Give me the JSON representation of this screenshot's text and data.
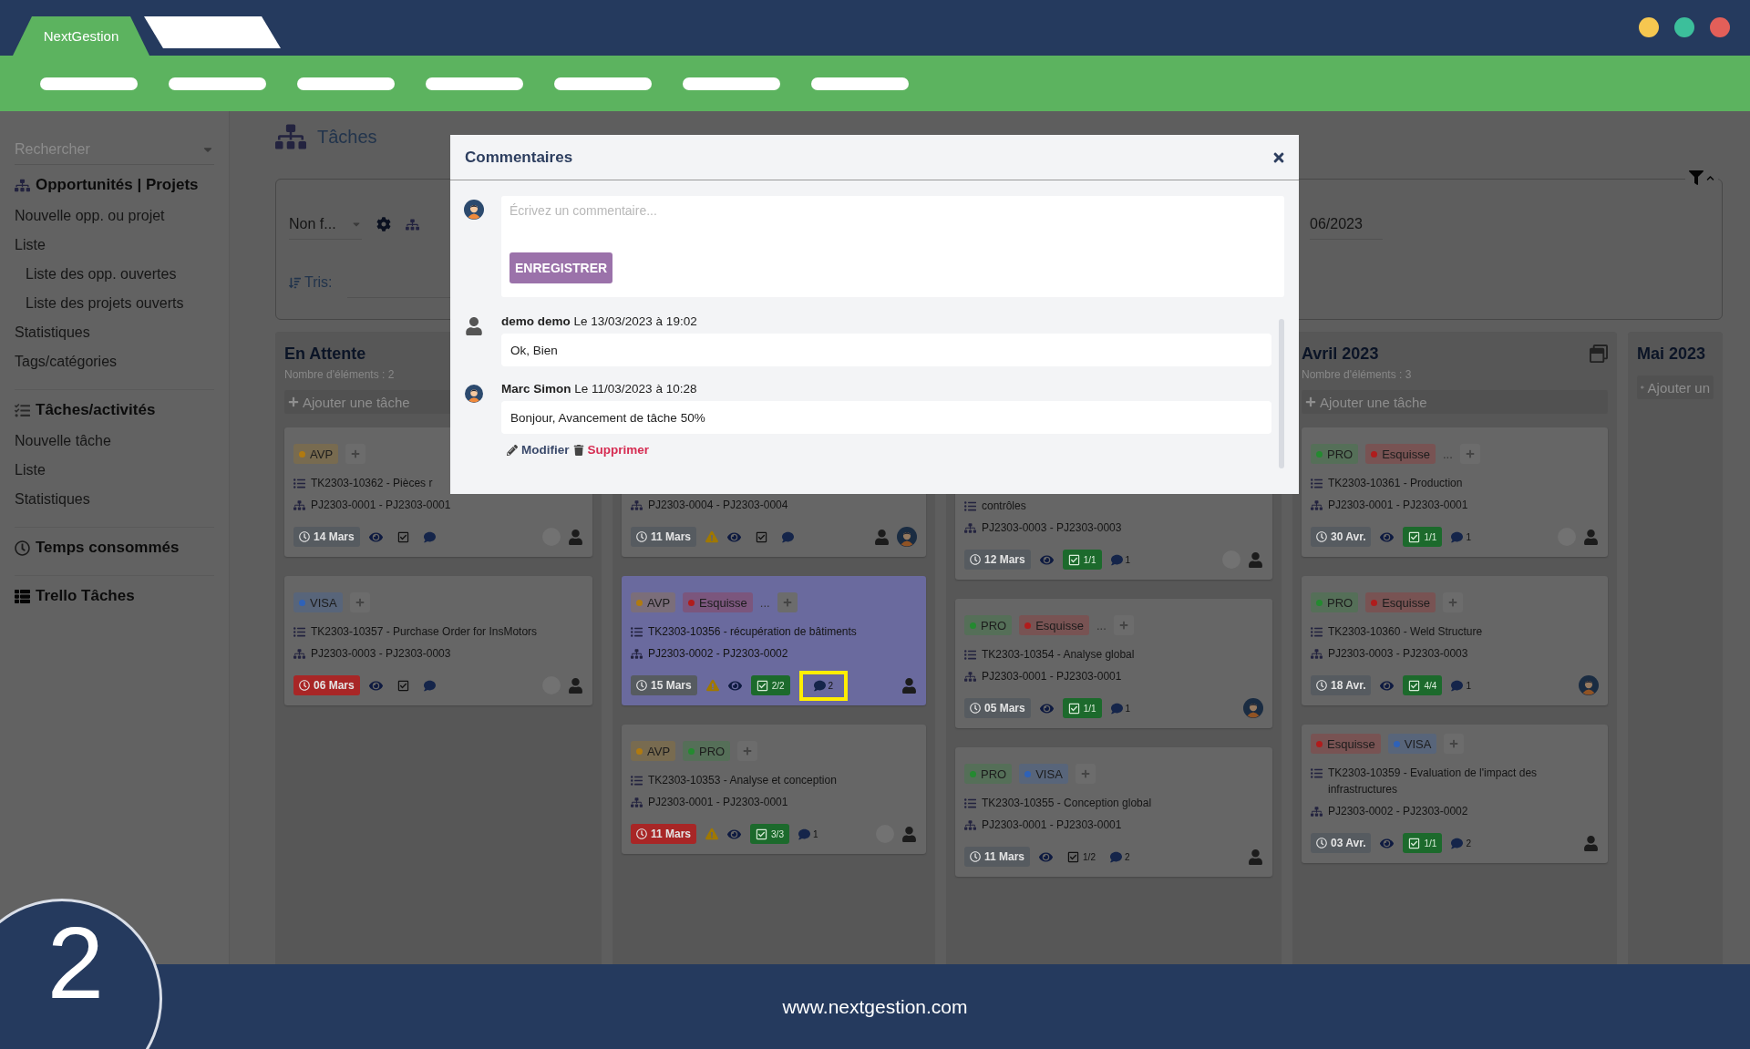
{
  "browser": {
    "tabs": [
      {
        "label": "NextGestion",
        "selected": true
      },
      {
        "selected": false
      }
    ]
  },
  "sidebar": {
    "search": {
      "placeholder": "Rechercher"
    },
    "sections": [
      {
        "title": "Opportunités | Projets",
        "items": [
          {
            "label": "Nouvelle opp. ou projet"
          },
          {
            "label": "Liste",
            "children": [
              {
                "label": "Liste des opp. ouvertes"
              },
              {
                "label": "Liste des projets ouverts"
              }
            ]
          },
          {
            "label": "Statistiques"
          },
          {
            "label": "Tags/catégories"
          }
        ]
      },
      {
        "title": "Tâches/activités",
        "items": [
          {
            "label": "Nouvelle tâche"
          },
          {
            "label": "Liste"
          },
          {
            "label": "Statistiques"
          }
        ]
      },
      {
        "title": "Temps consommés"
      },
      {
        "title": "Trello Tâches"
      }
    ]
  },
  "page": {
    "title": "Tâches"
  },
  "filters": {
    "status": "Non f...",
    "sort_label": "Tris:",
    "period": "06/2023",
    "expanded": true
  },
  "columns": [
    {
      "title": "En Attente",
      "count": "Nombre d'éléments : 2",
      "add": "Ajouter une tâche",
      "collapse_button": false,
      "cards": [
        {
          "tags": [
            {
              "label": "AVP",
              "color": "#b07a10"
            }
          ],
          "task": "TK2303-10362 - Pièces r",
          "project": "PJ2303-0001 - PJ2303-0001",
          "date": "14 Mars",
          "overdue": false,
          "warning": false,
          "checks_done": false,
          "comment_highlight": false,
          "selected": false,
          "assignees": [
            {
              "kind": "empty"
            },
            {
              "kind": "person"
            }
          ]
        },
        {
          "tags": [
            {
              "label": "VISA",
              "color": "#2f62b8"
            }
          ],
          "task": "TK2303-10357 - Purchase Order for InsMotors",
          "project": "PJ2303-0003 - PJ2303-0003",
          "date": "06 Mars",
          "overdue": true,
          "warning": false,
          "checks_done": false,
          "comment_highlight": false,
          "selected": false,
          "assignees": [
            {
              "kind": "empty"
            },
            {
              "kind": "person"
            }
          ]
        }
      ]
    },
    {
      "cards": [
        {
          "project": "PJ2303-0004 - PJ2303-0004",
          "date": "11 Mars",
          "overdue": false,
          "warning": true,
          "checks_done": false,
          "comment_highlight": false,
          "selected": false,
          "assignees": [
            {
              "kind": "person"
            },
            {
              "kind": "photo"
            }
          ]
        },
        {
          "tags": [
            {
              "label": "AVP",
              "color": "#b07a10"
            },
            {
              "label": "Esquisse",
              "color": "#b01c1c"
            }
          ],
          "more_tags": "...",
          "task": "TK2303-10356 - récupération de bâtiments",
          "project": "PJ2303-0002 - PJ2303-0002",
          "date": "15 Mars",
          "overdue": false,
          "warning": true,
          "checks": "2/2",
          "checks_done": true,
          "comments": "2",
          "comment_highlight": true,
          "selected": true,
          "assignees": [
            {
              "kind": "person"
            }
          ]
        },
        {
          "tags": [
            {
              "label": "AVP",
              "color": "#b07a10"
            },
            {
              "label": "PRO",
              "color": "#248a30"
            }
          ],
          "task": "TK2303-10353 - Analyse et conception",
          "project": "PJ2303-0001 - PJ2303-0001",
          "date": "11 Mars",
          "overdue": true,
          "warning": true,
          "checks": "3/3",
          "checks_done": true,
          "comments": "1",
          "comment_highlight": false,
          "selected": false,
          "assignees": [
            {
              "kind": "empty"
            },
            {
              "kind": "person"
            }
          ]
        }
      ]
    },
    {
      "cards": [
        {
          "task": "contrôles",
          "project": "PJ2303-0003 - PJ2303-0003",
          "date": "12 Mars",
          "overdue": false,
          "warning": false,
          "checks": "1/1",
          "checks_done": true,
          "comments": "1",
          "comment_highlight": false,
          "selected": false,
          "assignees": [
            {
              "kind": "empty"
            },
            {
              "kind": "person"
            }
          ]
        },
        {
          "tags": [
            {
              "label": "PRO",
              "color": "#248a30"
            },
            {
              "label": "Esquisse",
              "color": "#b01c1c"
            }
          ],
          "more_tags": "...",
          "task": "TK2303-10354 - Analyse global",
          "project": "PJ2303-0001 - PJ2303-0001",
          "date": "05 Mars",
          "overdue": false,
          "warning": false,
          "checks": "1/1",
          "checks_done": true,
          "comments": "1",
          "comment_highlight": false,
          "selected": false,
          "assignees": [
            {
              "kind": "photo"
            }
          ]
        },
        {
          "tags": [
            {
              "label": "PRO",
              "color": "#248a30"
            },
            {
              "label": "VISA",
              "color": "#2f62b8"
            }
          ],
          "task": "TK2303-10355 - Conception global",
          "project": "PJ2303-0001 - PJ2303-0001",
          "date": "11 Mars",
          "overdue": false,
          "warning": false,
          "checks": "1/2",
          "checks_done": false,
          "comments": "2",
          "comment_highlight": false,
          "selected": false,
          "assignees": [
            {
              "kind": "person"
            }
          ]
        }
      ]
    },
    {
      "title": "Avril 2023",
      "count": "Nombre d'éléments : 3",
      "add": "Ajouter une tâche",
      "collapse_button": true,
      "cards": [
        {
          "tags": [
            {
              "label": "PRO",
              "color": "#248a30"
            },
            {
              "label": "Esquisse",
              "color": "#b01c1c"
            }
          ],
          "more_tags": "...",
          "task": "TK2303-10361 - Production",
          "project": "PJ2303-0001 - PJ2303-0001",
          "date": "30 Avr.",
          "overdue": false,
          "warning": false,
          "checks": "1/1",
          "checks_done": true,
          "comments": "1",
          "comment_highlight": false,
          "selected": false,
          "assignees": [
            {
              "kind": "empty"
            },
            {
              "kind": "person"
            }
          ]
        },
        {
          "tags": [
            {
              "label": "PRO",
              "color": "#248a30"
            },
            {
              "label": "Esquisse",
              "color": "#b01c1c"
            }
          ],
          "task": "TK2303-10360 - Weld Structure",
          "project": "PJ2303-0003 - PJ2303-0003",
          "date": "18 Avr.",
          "overdue": false,
          "warning": false,
          "checks": "4/4",
          "checks_done": true,
          "comments": "1",
          "comment_highlight": false,
          "selected": false,
          "assignees": [
            {
              "kind": "photo"
            }
          ]
        },
        {
          "tags": [
            {
              "label": "Esquisse",
              "color": "#b01c1c"
            },
            {
              "label": "VISA",
              "color": "#2f62b8"
            }
          ],
          "task": "TK2303-10359 - Evaluation de l'impact des infrastructures",
          "project": "PJ2303-0002 - PJ2303-0002",
          "date": "03 Avr.",
          "overdue": false,
          "warning": false,
          "checks": "1/1",
          "checks_done": true,
          "comments": "2",
          "comment_highlight": false,
          "selected": false,
          "assignees": [
            {
              "kind": "person"
            }
          ]
        }
      ]
    },
    {
      "title": "Mai 2023",
      "add": "Ajouter un",
      "collapse_button": false
    }
  ],
  "modal": {
    "title": "Commentaires",
    "composer": {
      "avatar": {
        "kind": "photo"
      },
      "placeholder": "Écrivez un commentaire...",
      "button": "ENREGISTRER"
    },
    "comments": [
      {
        "avatar": {
          "kind": "person"
        },
        "author": "demo demo",
        "date": "Le 13/03/2023 à 19:02",
        "text": "Ok, Bien"
      },
      {
        "avatar": {
          "kind": "photo"
        },
        "author": "Marc Simon",
        "date": "Le 11/03/2023 à 10:28",
        "text": "Bonjour, Avancement de tâche 50%",
        "actions": [
          {
            "kind": "edit",
            "label": "Modifier"
          },
          {
            "kind": "delete",
            "label": "Supprimer"
          }
        ]
      }
    ]
  },
  "footer": {
    "website": "www.nextgestion.com",
    "step": "2"
  }
}
